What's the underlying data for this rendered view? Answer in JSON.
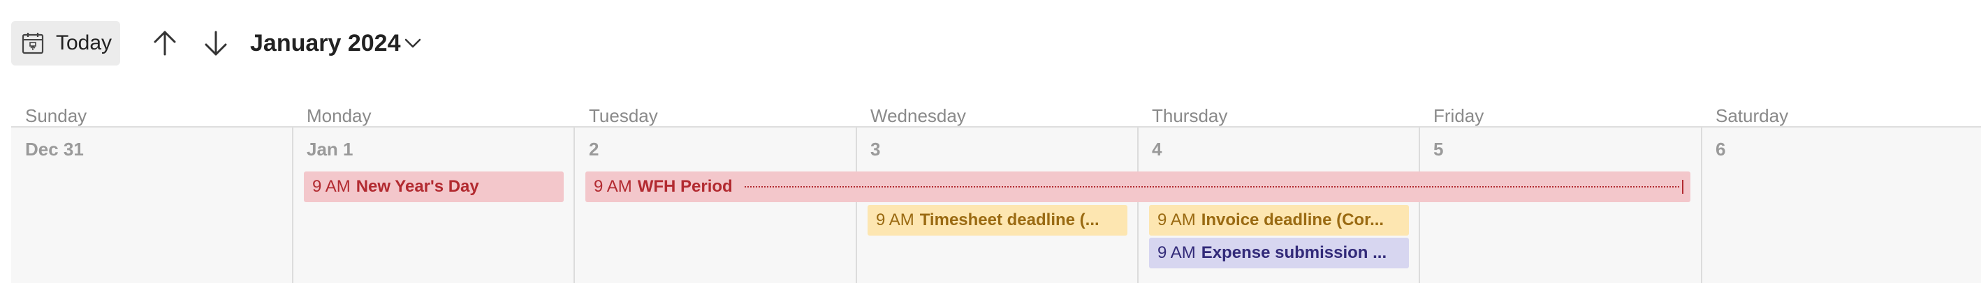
{
  "toolbar": {
    "today_label": "Today",
    "month_label": "January 2024"
  },
  "weekdays": [
    "Sunday",
    "Monday",
    "Tuesday",
    "Wednesday",
    "Thursday",
    "Friday",
    "Saturday"
  ],
  "days": [
    "Dec 31",
    "Jan 1",
    "2",
    "3",
    "4",
    "5",
    "6"
  ],
  "events": {
    "new_years": {
      "time": "9 AM",
      "title": "New Year's Day"
    },
    "wfh": {
      "time": "9 AM",
      "title": "WFH Period"
    },
    "timesheet": {
      "time": "9 AM",
      "title": "Timesheet deadline (..."
    },
    "invoice": {
      "time": "9 AM",
      "title": "Invoice deadline (Cor..."
    },
    "expense": {
      "time": "9 AM",
      "title": "Expense submission ..."
    }
  },
  "colors": {
    "red_bg": "#f3c7cb",
    "red_text": "#b22a30",
    "yellow_bg": "#fde6b1",
    "yellow_text": "#9a6a12",
    "purple_bg": "#d7d6f0",
    "purple_text": "#322a79"
  },
  "icons": {
    "today": "calendar-today-icon",
    "up": "arrow-up-icon",
    "down": "arrow-down-icon",
    "chevron": "chevron-down-icon"
  }
}
